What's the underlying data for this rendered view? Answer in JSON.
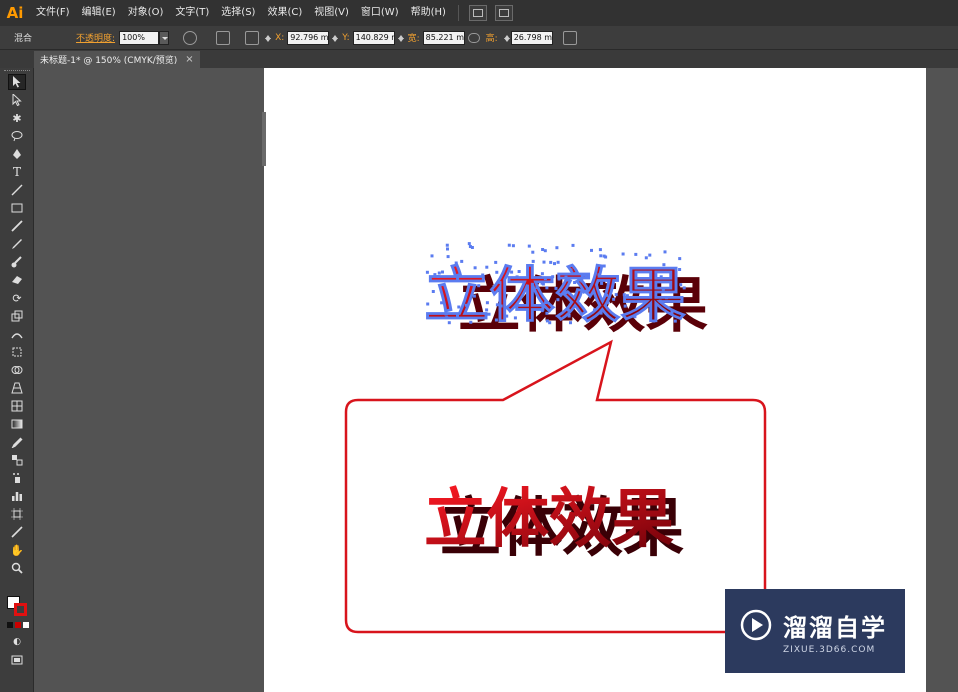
{
  "app": {
    "logo": "Ai",
    "menus": [
      "文件(F)",
      "编辑(E)",
      "对象(O)",
      "文字(T)",
      "选择(S)",
      "效果(C)",
      "视图(V)",
      "窗口(W)",
      "帮助(H)"
    ]
  },
  "control_bar": {
    "mode_label": "混合",
    "opacity_label": "不透明度:",
    "opacity_value": "100%",
    "x_label": "X:",
    "x_value": "92.796 mm",
    "y_label": "Y:",
    "y_value": "140.829 mm",
    "w_label": "宽:",
    "w_value": "85.221 mm",
    "h_label": "高:",
    "h_value": "26.798 mm"
  },
  "document": {
    "tab_title": "未标题-1* @ 150% (CMYK/预览)",
    "tab_close": "×"
  },
  "artwork": {
    "top_text": "立体效果",
    "bottom_text": "立体效果",
    "text_color": "#cc0010",
    "anchor_color": "#5b7cf0",
    "bubble_stroke": "#d8141c"
  },
  "watermark": {
    "main": "溜溜自学",
    "sub": "ZIXUE.3D66.COM",
    "background": "#2c3a5e"
  },
  "tools": [
    "selection-tool-icon",
    "direct-selection-tool-icon",
    "magic-wand-tool-icon",
    "lasso-tool-icon",
    "pen-tool-icon",
    "type-tool-icon",
    "line-tool-icon",
    "rectangle-tool-icon",
    "paintbrush-tool-icon",
    "pencil-tool-icon",
    "blob-brush-tool-icon",
    "eraser-tool-icon",
    "rotate-tool-icon",
    "scale-tool-icon",
    "width-tool-icon",
    "free-transform-tool-icon",
    "shape-builder-tool-icon",
    "perspective-grid-tool-icon",
    "mesh-tool-icon",
    "gradient-tool-icon",
    "eyedropper-tool-icon",
    "blend-tool-icon",
    "symbol-sprayer-tool-icon",
    "column-graph-tool-icon",
    "artboard-tool-icon",
    "slice-tool-icon",
    "hand-tool-icon",
    "zoom-tool-icon"
  ]
}
